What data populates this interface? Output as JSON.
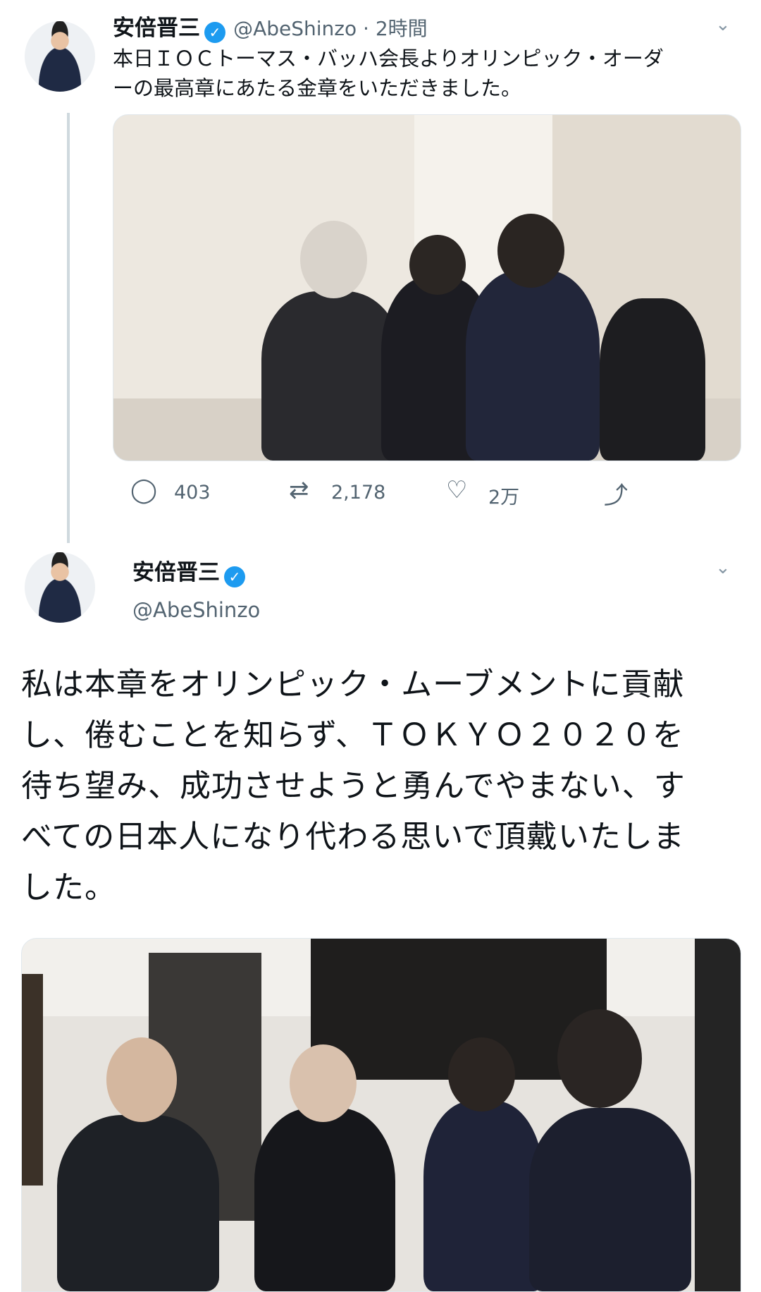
{
  "tweet1": {
    "name": "安倍晋三",
    "handle_time": "@AbeShinzo · 2時間",
    "text_line1": "本日ＩＯＣトーマス・バッハ会長よりオリンピック・オーダ",
    "text_line2": "ーの最高章にあたる金章をいただきました。",
    "photo_alt": "photo",
    "stats": {
      "replies": "403",
      "retweets": "2,178",
      "likes": "2万"
    }
  },
  "tweet2": {
    "name": "安倍晋三",
    "handle": "@AbeShinzo",
    "lines": [
      "私は本章をオリンピック・ムーブメントに貢献",
      "し、倦むことを知らず、ＴＯＫＹＯ２０２０を",
      "待ち望み、成功させようと勇んでやまない、す",
      "べての日本人になり代わる思いで頂戴いたしま",
      "した。"
    ]
  },
  "icons": {
    "verified": "verified-badge-icon",
    "more": "chevron-down-icon",
    "reply": "reply-icon",
    "retweet": "retweet-icon",
    "like": "heart-icon",
    "share": "share-icon"
  },
  "colors": {
    "verified": "#1d9bf0",
    "muted": "#536471",
    "thread_line": "#cfd9de"
  }
}
